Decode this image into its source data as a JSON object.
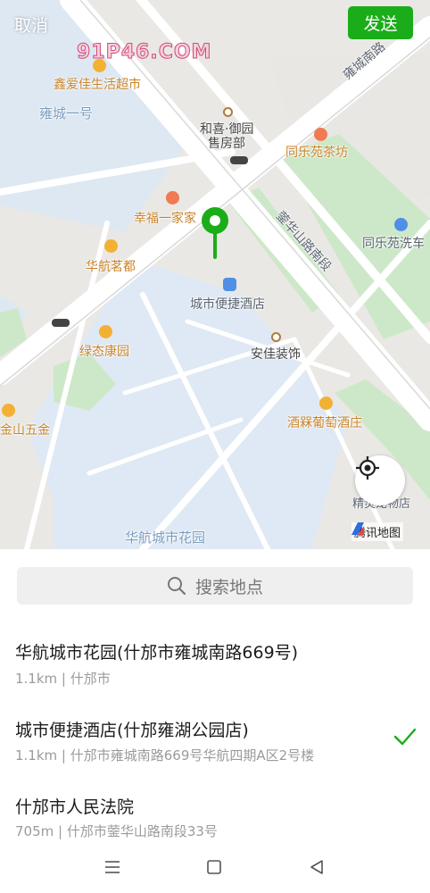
{
  "topbar": {
    "cancel_label": "取消",
    "send_label": "发送"
  },
  "watermark": {
    "text": "91P46.COM"
  },
  "map": {
    "labels": {
      "supermarket": "鑫爱佳生活超市",
      "yongcheng1": "雍城一号",
      "hexi_line1": "和喜·御园",
      "hexi_line2": "售房部",
      "tea": "同乐苑茶坊",
      "road_yongcheng_south": "雍城南路",
      "road_yuanhua": "蓥华山路南段",
      "carwash": "同乐苑洗车",
      "happy_family": "幸福一家家",
      "huahang_tea": "华航茗都",
      "hotel": "城市便捷酒店",
      "lvtai": "绿态康园",
      "anjia": "安佳装饰",
      "wine": "酒槑葡萄酒庄",
      "jinshan": "金山五金",
      "petstore": "精灵宠物店",
      "garden": "华航城市花园"
    },
    "brand": "腾讯地图",
    "icons": {
      "pin": "location-pin-icon",
      "locate": "locate-crosshair-icon"
    },
    "colors": {
      "pin": "#1aad19",
      "send": "#1aad19",
      "check": "#1aad19"
    }
  },
  "search": {
    "placeholder": "搜索地点"
  },
  "results": [
    {
      "title": "华航城市花园(什邡市雍城南路669号)",
      "distance": "1.1km",
      "address": "什邡市",
      "selected": false
    },
    {
      "title": "城市便捷酒店(什邡雍湖公园店)",
      "distance": "1.1km",
      "address": "什邡市雍城南路669号华航四期A区2号楼",
      "selected": true
    },
    {
      "title": "什邡市人民法院",
      "distance": "705m",
      "address": "什邡市蓥华山路南段33号",
      "selected": false
    }
  ],
  "separator": " | "
}
